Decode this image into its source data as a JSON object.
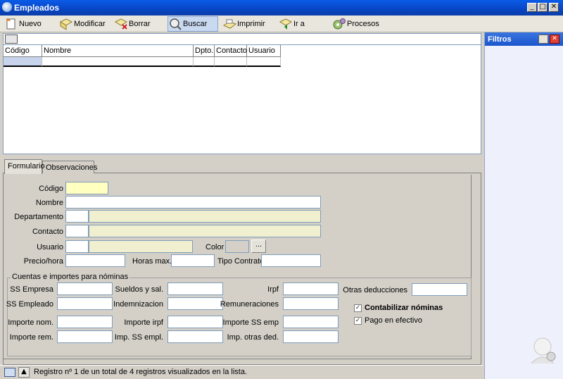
{
  "window": {
    "title": "Empleados"
  },
  "toolbar": {
    "buttons": [
      {
        "label": "Nuevo"
      },
      {
        "label": "Modificar"
      },
      {
        "label": "Borrar"
      },
      {
        "label": "Buscar"
      },
      {
        "label": "Imprimir"
      },
      {
        "label": "Ir a"
      },
      {
        "label": "Procesos"
      }
    ]
  },
  "search": {
    "value": ""
  },
  "grid": {
    "columns": [
      "Código",
      "Nombre",
      "Dpto.",
      "Contacto",
      "Usuario"
    ]
  },
  "tabs": [
    {
      "label": "Formulario",
      "selected": true
    },
    {
      "label": "Observaciones",
      "selected": false
    }
  ],
  "form": {
    "codigo_label": "Código",
    "nombre_label": "Nombre",
    "departamento_label": "Departamento",
    "contacto_label": "Contacto",
    "usuario_label": "Usuario",
    "color_label": "Color",
    "color_button": "...",
    "precio_label": "Precio/hora",
    "horas_label": "Horas max.",
    "tipo_label": "Tipo Contrato"
  },
  "nominas": {
    "title": "Cuentas e importes para nóminas",
    "ss_empresa": "SS Empresa",
    "ss_empleado": "SS Empleado",
    "importe_nom": "Importe nom.",
    "importe_rem": "Importe rem.",
    "sueldos": "Sueldos y sal.",
    "indemnizacion": "Indemnizacion",
    "importe_irpf": "Importe irpf",
    "imp_ss_empl": "Imp. SS empl.",
    "irpf": "Irpf",
    "remuneraciones": "Remuneraciones",
    "importe_ss_emp": "Importe SS emp",
    "imp_otras_ded": "Imp. otras ded.",
    "otras_deducciones": "Otras deducciones",
    "contabilizar": "Contabilizar nóminas",
    "contabilizar_checked": true,
    "pago_efectivo": "Pago en efectivo",
    "pago_checked": true
  },
  "status": {
    "text": "Registro nº 1 de un total de 4 registros visualizados en la lista."
  },
  "filters": {
    "title": "Filtros"
  },
  "colors": {
    "titlebar": "#0a5ce8",
    "field_yellow": "#ffffc0",
    "filters_header": "#1a56cc"
  }
}
